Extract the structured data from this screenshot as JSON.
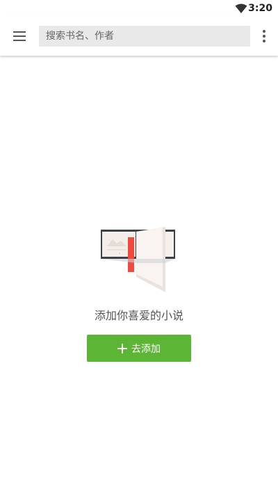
{
  "status_bar": {
    "time": "3:20",
    "wifi_icon": "wifi-icon"
  },
  "toolbar": {
    "menu_icon": "hamburger-menu-icon",
    "search_placeholder": "搜索书名、作者",
    "more_icon": "more-vert-icon"
  },
  "empty_state": {
    "illustration": "open-book-illustration",
    "message": "添加你喜爱的小说",
    "add_button_label": "去添加",
    "add_icon": "plus-icon"
  },
  "colors": {
    "accent_green": "#5cb535",
    "bookmark_red": "#f0493e",
    "search_bg": "#e9e9e9"
  }
}
